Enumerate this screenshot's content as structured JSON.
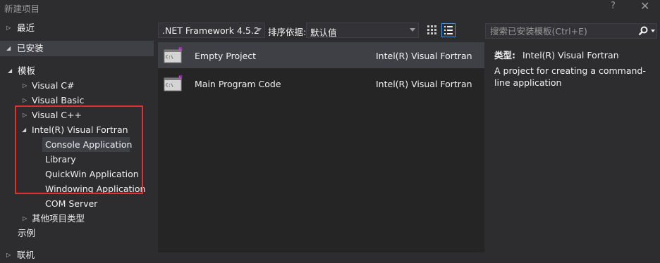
{
  "window": {
    "title": "新建项目",
    "help_label": "?",
    "close_label": "✕"
  },
  "tree": {
    "recent": "最近",
    "installed": "已安装",
    "templates": "模板",
    "visual_csharp": "Visual C#",
    "visual_basic": "Visual Basic",
    "visual_cpp": "Visual C++",
    "intel_fortran": "Intel(R) Visual Fortran",
    "children": [
      "Console Application",
      "Library",
      "QuickWin Application",
      "Windowing Application",
      "COM Server"
    ],
    "other_types": "其他项目类型",
    "samples": "示例",
    "online": "联机"
  },
  "toolbar": {
    "framework": ".NET Framework 4.5.2",
    "sort_label": "排序依据:",
    "sort_value": "默认值"
  },
  "projects": [
    {
      "name": "Empty Project",
      "language": "Intel(R) Visual Fortran"
    },
    {
      "name": "Main Program Code",
      "language": "Intel(R) Visual Fortran"
    }
  ],
  "icon_badge": "F",
  "icon_caption": "C:\\",
  "search": {
    "placeholder": "搜索已安装模板(Ctrl+E)"
  },
  "details": {
    "type_label": "类型:",
    "type_value": "Intel(R) Visual Fortran",
    "description": "A project for creating a command-line application"
  },
  "colors": {
    "accent": "#3399ff",
    "highlight_box": "#e03131",
    "badge": "#c93fe0"
  }
}
